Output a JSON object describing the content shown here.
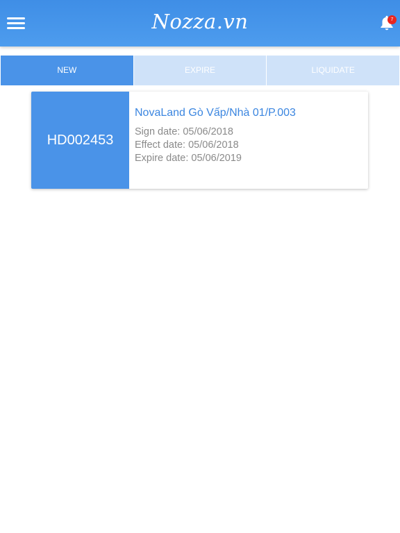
{
  "header": {
    "title": "Nozza.vn",
    "notification_count": "7",
    "menu_icon": "hamburger-menu-icon",
    "bell_icon": "bell-icon",
    "badge_color": "#e8261f"
  },
  "tabs": [
    {
      "label": "NEW",
      "active": true
    },
    {
      "label": "EXPIRE",
      "active": false
    },
    {
      "label": "LIQUIDATE",
      "active": false
    }
  ],
  "colors": {
    "accent": "#4a93e8",
    "tab_inactive": "#cfe2f9",
    "title_text": "#3b86e0",
    "muted_text": "#8a8a8a"
  },
  "contracts": [
    {
      "code": "HD002453",
      "title": "NovaLand Gò Vấp/Nhà 01/P.003",
      "sign_date": "Sign date: 05/06/2018",
      "effect_date": "Effect date: 05/06/2018",
      "expire_date": "Expire date: 05/06/2019"
    }
  ]
}
